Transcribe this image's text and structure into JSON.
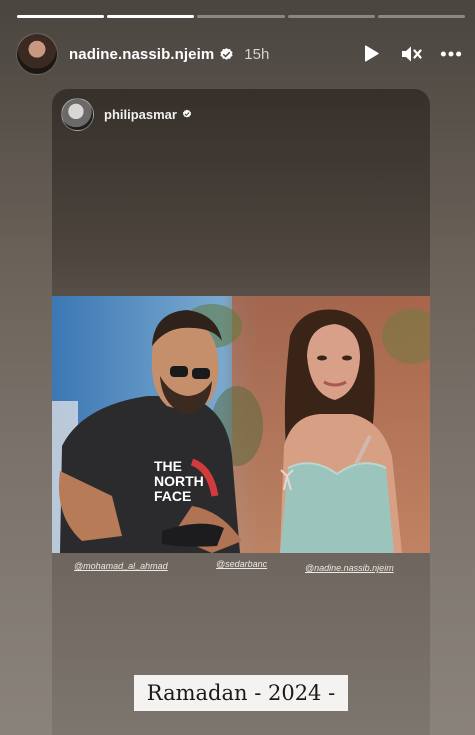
{
  "story": {
    "progress": [
      1,
      1,
      0,
      0,
      0
    ]
  },
  "header": {
    "username": "nadine.nassib.njeim",
    "time": "15h",
    "avatar_icon": "profile-avatar",
    "verified_icon": "verified-badge-icon",
    "controls": {
      "play_icon": "play-icon",
      "mute_icon": "muted-speaker-icon",
      "more_icon": "more-options-icon"
    }
  },
  "shared_post": {
    "username": "philipasmar",
    "tags": [
      "@mohamad_al_ahmad",
      "@sedarbanc",
      "@nadine.nassib.njeim"
    ],
    "caption": "Ramadan - 2024 -",
    "brand_text": "THE NORTH FACE"
  },
  "colors": {
    "verified_badge": "#ffffff",
    "progress_active": "#ffffff",
    "progress_inactive": "rgba(255,255,255,0.35)",
    "caption_bg": "#f4f3f1"
  }
}
